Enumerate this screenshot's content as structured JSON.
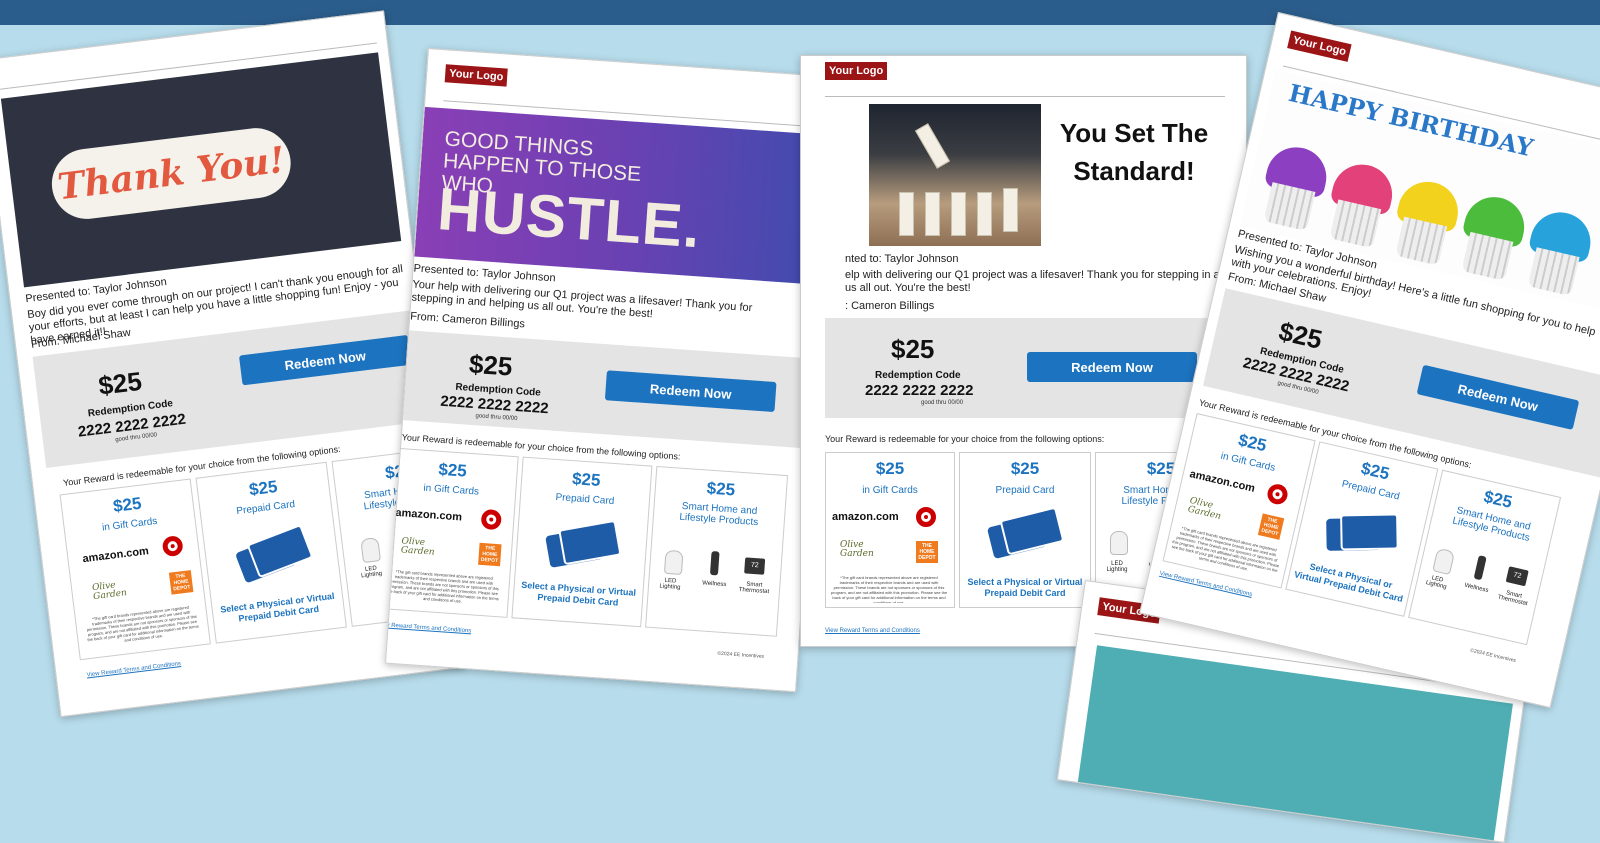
{
  "logo_text": "Your Logo",
  "cards": [
    {
      "banner_text": "Thank You!",
      "presented": "Presented to: Taylor Johnson",
      "message": "Boy did you ever come through on our project! I can't thank you enough for all your efforts, but at least I can help you have a little shopping fun! Enjoy - you have earned it!!",
      "from": "From: Michael Shaw"
    },
    {
      "banner_small": "GOOD THINGS HAPPEN TO THOSE WHO",
      "banner_big": "HUSTLE.",
      "presented": "Presented to: Taylor Johnson",
      "message": "Your help with delivering our Q1 project was a lifesaver! Thank you for stepping in and helping us all out. You're the best!",
      "from": "From: Cameron Billings"
    },
    {
      "headline": "You Set The Standard!",
      "presented": "nted to: Taylor Johnson",
      "message": "elp with delivering our Q1 project was a lifesaver! Thank you for stepping in and g us all out. You're the best!",
      "from": ": Cameron Billings"
    },
    {
      "banner_text": "HAPPY BIRTHDAY",
      "presented": "Presented to: Taylor Johnson",
      "message": "Wishing you a wonderful birthday! Here's a little fun shopping for you to help with your celebrations. Enjoy!",
      "from": "From: Michael Shaw"
    }
  ],
  "reward": {
    "amount": "$25",
    "code_label": "Redemption Code",
    "code": "2222 2222 2222",
    "good_thru": "good thru 00/00",
    "redeem_label": "Redeem Now",
    "choice_text": "Your Reward is redeemable for your choice from the following options:"
  },
  "options": {
    "gift": {
      "amount": "$25",
      "title": "in Gift Cards"
    },
    "prepaid": {
      "amount": "$25",
      "title": "Prepaid Card",
      "subtitle": "Select a Physical or Virtual Prepaid Debit Card"
    },
    "smart": {
      "amount": "$25",
      "title": "Smart Home and Lifestyle Products",
      "items": [
        "LED Lighting",
        "Wellness",
        "Smart Thermostat"
      ]
    }
  },
  "brands": {
    "amazon": "amazon.com",
    "target": "TARGET",
    "olive": "Olive Garden",
    "homedepot": "THE HOME DEPOT"
  },
  "fine_print": "*The gift card brands represented above are registered trademarks of their respective brands and are used with permission. These brands are not sponsors or sponsors of this program, and are not affiliated with this promotion. Please see the back of your gift card for additional information on the terms and conditions of use.",
  "terms_link": "View Reward Terms and Conditions",
  "copyright": "©2024 EE Incentives",
  "thermostat_display": "72"
}
